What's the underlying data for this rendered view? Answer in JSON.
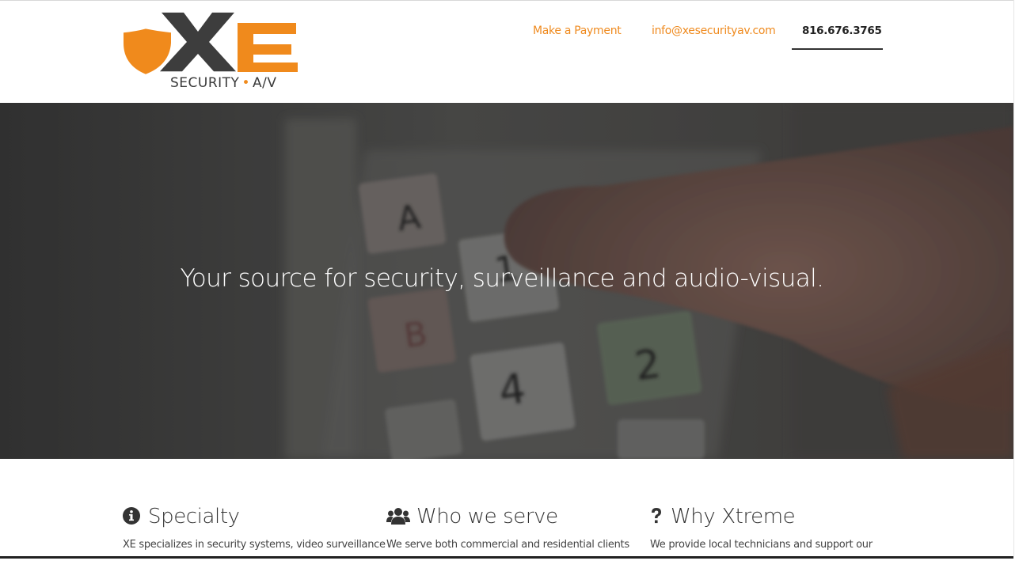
{
  "brand": {
    "logo_letters": "XE",
    "tagline_left": "SECURITY",
    "tagline_dot": "•",
    "tagline_right": "A/V"
  },
  "nav": {
    "payment": "Make a Payment",
    "email": "info@xesecurityav.com",
    "phone": "816.676.3765"
  },
  "hero": {
    "headline": "Your source for security, surveillance and audio-visual."
  },
  "features": [
    {
      "icon": "info-circle-icon",
      "title": "Specialty",
      "desc": "XE specializes in security systems, video surveillance"
    },
    {
      "icon": "users-icon",
      "title": "Who we serve",
      "desc": "We serve both commercial and residential clients"
    },
    {
      "icon": "question-icon",
      "title": "Why Xtreme",
      "desc": "We provide local technicians and support our"
    }
  ],
  "colors": {
    "accent": "#f08a1c",
    "dark": "#3a3a3a"
  }
}
